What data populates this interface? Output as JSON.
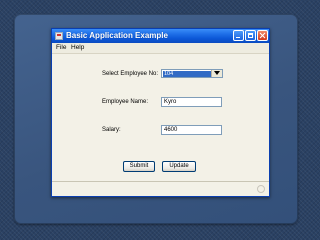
{
  "window": {
    "title": "Basic Application Example"
  },
  "menu": {
    "file": "File",
    "help": "Help"
  },
  "form": {
    "employee_no_label": "Select Employee No:",
    "employee_no_value": "104",
    "employee_name_label": "Employee Name:",
    "employee_name_value": "Kyro",
    "salary_label": "Salary:",
    "salary_value": "4600"
  },
  "buttons": {
    "submit": "Submit",
    "update": "Update"
  },
  "colors": {
    "titlebar": "#0b56d6",
    "selection": "#316ac5",
    "window_bg": "#f3f1e7",
    "slide_bg": "#2a4163"
  }
}
